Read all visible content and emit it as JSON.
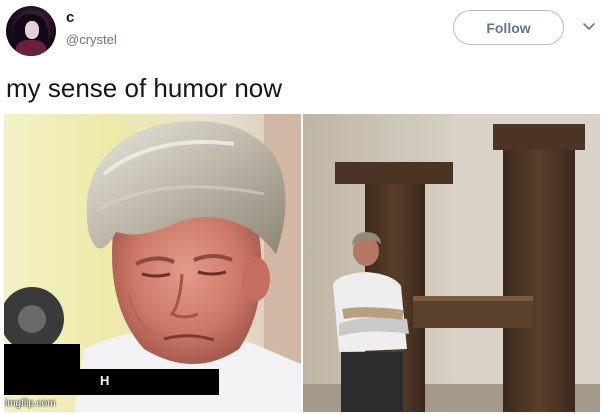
{
  "user": {
    "display_name": "c",
    "handle": "@crystel"
  },
  "follow_button": {
    "label": "Follow"
  },
  "tweet": {
    "text": "my sense of humor now"
  },
  "media": {
    "left_caption": "H",
    "watermark": "imgflip.com"
  },
  "icons": {
    "avatar": "avatar-icon",
    "more": "chevron-down-icon"
  },
  "colors": {
    "follow_border": "#b9bfc5",
    "secondary_text": "#657786",
    "primary_text": "#14171a"
  }
}
